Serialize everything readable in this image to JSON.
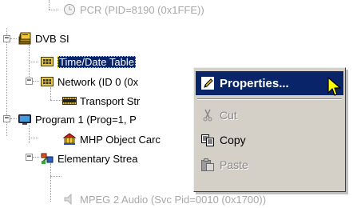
{
  "tree": {
    "items": [
      {
        "label": "PCR (PID=8190 (0x1FFE))",
        "icon": "clock-icon",
        "faded": true
      },
      {
        "label": "DVB SI",
        "icon": "book-stack-icon",
        "expander": "-"
      },
      {
        "label": "Time/Date Table",
        "icon": "table-icon",
        "selected": true
      },
      {
        "label": "Network (ID 0 (0x",
        "icon": "table-icon",
        "expander": "-"
      },
      {
        "label": "Transport Str",
        "icon": "film-strip-icon"
      },
      {
        "label": "Program 1 (Prog=1, P",
        "icon": "monitor-icon",
        "expander": "-"
      },
      {
        "label": "MHP Object Carc",
        "icon": "carousel-icon"
      },
      {
        "label": "Elementary Strea",
        "icon": "elementary-stream-icon",
        "expander": "-"
      },
      {
        "label": "MPEG 2 Audio (Svc Pid=0010 (0x1700))",
        "icon": "audio-icon",
        "faded": true
      }
    ]
  },
  "context_menu": {
    "items": [
      {
        "label": "Properties...",
        "icon": "pencil-icon",
        "highlighted": true
      },
      {
        "label": "Cut",
        "icon": "scissors-icon",
        "disabled": true
      },
      {
        "label": "Copy",
        "icon": "copy-icon"
      },
      {
        "label": "Paste",
        "icon": "paste-icon",
        "disabled": true
      }
    ]
  },
  "colors": {
    "selection": "#0a246a",
    "menu_bg": "#d4d0c8",
    "cursor": "#ffff00"
  }
}
